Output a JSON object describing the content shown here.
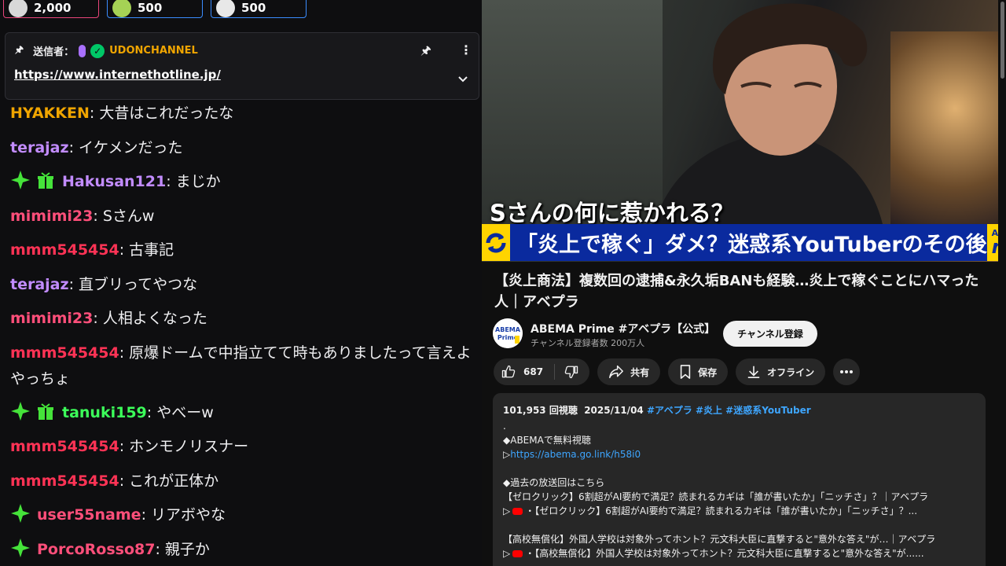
{
  "chat": {
    "badges": [
      {
        "value": "2,000",
        "color": "#e9457a"
      },
      {
        "value": "500",
        "color": "#3a8cff"
      },
      {
        "value": "500",
        "color": "#3a8cff"
      }
    ],
    "pinned": {
      "sender_label": "送信者：",
      "sender_name": "UDONCHANNEL",
      "url": "https://www.internethotline.jp/",
      "pin_icon": "pin-icon",
      "more_icon": "more-vertical-icon",
      "expand_icon": "chevron-down-icon"
    },
    "messages": [
      {
        "user": "HYAKKEN",
        "color": "#f0a500",
        "text": "大昔はこれだったな",
        "badges": []
      },
      {
        "user": "terajaz",
        "color": "#c28cff",
        "text": "イケメンだった",
        "badges": []
      },
      {
        "user": "Hakusan121",
        "color": "#c28cff",
        "text": "まじか",
        "badges": [
          "sparkle-icon",
          "gift-icon"
        ]
      },
      {
        "user": "mimimi23",
        "color": "#ff4f7a",
        "text": "Sさんw",
        "badges": []
      },
      {
        "user": "mmm545454",
        "color": "#ff3355",
        "text": "古事記",
        "badges": []
      },
      {
        "user": "terajaz",
        "color": "#c28cff",
        "text": "直ブリってやつな",
        "badges": []
      },
      {
        "user": "mimimi23",
        "color": "#ff4f7a",
        "text": "人相よくなった",
        "badges": []
      },
      {
        "user": "mmm545454",
        "color": "#ff3355",
        "text": "原爆ドームで中指立てて時もありましたって言えよやっちょ",
        "badges": []
      },
      {
        "user": "tanuki159",
        "color": "#3cff5a",
        "text": "やべーw",
        "badges": [
          "sparkle-icon",
          "gift-icon"
        ]
      },
      {
        "user": "mmm545454",
        "color": "#ff3355",
        "text": "ホンモノリスナー",
        "badges": []
      },
      {
        "user": "mmm545454",
        "color": "#ff3355",
        "text": "これが正体か",
        "badges": []
      },
      {
        "user": "user55name",
        "color": "#ff4f7a",
        "text": "リアボやな",
        "badges": [
          "sparkle-icon"
        ]
      },
      {
        "user": "PorcoRosso87",
        "color": "#ff4f7a",
        "text": "親子か",
        "badges": [
          "sparkle-icon"
        ]
      }
    ]
  },
  "youtube": {
    "video": {
      "subtitle": "Sさんの何に惹かれる？",
      "ticker": "「炎上で稼ぐ」ダメ？迷惑系YouTuberのその後",
      "logo_line1": "ABEMA",
      "logo_line2": "news"
    },
    "title": "【炎上商法】複数回の逮捕&永久垢BANも経験…炎上で稼ぐことにハマった人｜アベプラ",
    "channel": {
      "name": "ABEMA Prime #アベプラ【公式】",
      "subscribers": "チャンネル登録者数 200万人",
      "avatar_text": "ABEMA Prime"
    },
    "subscribe_label": "チャンネル登録",
    "actions": {
      "likes": "687",
      "share": "共有",
      "save": "保存",
      "offline": "オフライン"
    },
    "description": {
      "views": "101,953 回視聴",
      "date": "2025/11/04",
      "tags": "#アベプラ #炎上 #迷惑系YouTuber",
      "dot": ".",
      "line_abema": "◆ABEMAで無料視聴",
      "link_prefix": "▷",
      "link": "https://abema.go.link/h58i0",
      "line_past": "◆過去の放送回はこちら",
      "past1_title": "【ゼロクリック】6割超がAI要約で満足？読まれるカギは「誰が書いたか」「ニッチさ」？｜アベプラ",
      "past1_link": "・【ゼロクリック】6割超がAI要約で満足？読まれるカギは「誰が書いたか」「ニッチさ」？...",
      "past2_title": "【高校無償化】外国人学校は対象外ってホント？元文科大臣に直撃すると\"意外な答え\"が…｜アベプラ",
      "past2_link": "・【高校無償化】外国人学校は対象外ってホント？元文科大臣に直撃すると\"意外な答え\"が......"
    }
  }
}
